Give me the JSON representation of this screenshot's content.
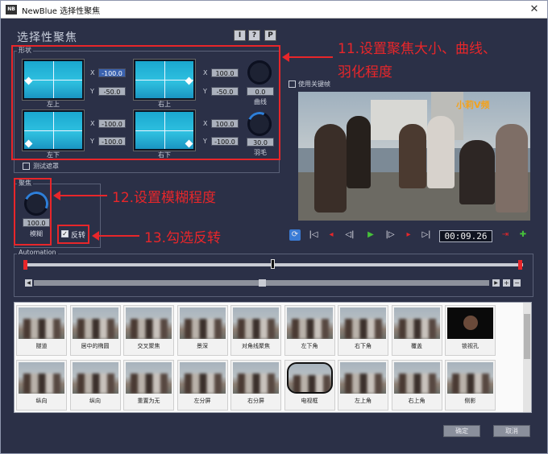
{
  "window": {
    "app_icon_text": "NB",
    "title": "NewBlue 选择性聚焦",
    "close_glyph": "✕"
  },
  "dialog": {
    "title": "选择性聚焦",
    "header_buttons": [
      "I",
      "?",
      "P"
    ]
  },
  "shape_group": {
    "label": "形状",
    "pads": [
      {
        "name": "top-left",
        "label": "左上",
        "x": "-100.0",
        "y": "-50.0"
      },
      {
        "name": "top-right",
        "label": "右上",
        "x": "100.0",
        "y": "-50.0"
      },
      {
        "name": "bottom-left",
        "label": "左下",
        "x": "-100.0",
        "y": "-100.0"
      },
      {
        "name": "bottom-right",
        "label": "右下",
        "x": "100.0",
        "y": "-100.0"
      }
    ],
    "curve_knob": {
      "value": "0.0",
      "label": "曲线"
    },
    "feather_knob": {
      "value": "30.0",
      "label": "羽毛"
    },
    "test_mask_label": "测试遮罩"
  },
  "focus_group": {
    "label": "聚焦",
    "blur_knob": {
      "value": "100.0",
      "label": "模糊"
    },
    "invert_label": "反转",
    "invert_checked": true
  },
  "keyframes": {
    "label": "使用关键帧"
  },
  "video": {
    "watermark": "小莉V频"
  },
  "transport": {
    "timecode": "00:09.26",
    "icons": [
      "loop-icon",
      "go-start-icon",
      "prev-keyframe-icon",
      "step-back-icon",
      "play-icon",
      "step-forward-icon",
      "next-keyframe-icon",
      "go-end-icon",
      "delete-keyframe-icon",
      "add-keyframe-icon"
    ]
  },
  "automation": {
    "label": "Automation"
  },
  "presets": [
    {
      "label": "隧道"
    },
    {
      "label": "居中的椭圆"
    },
    {
      "label": "交叉聚焦"
    },
    {
      "label": "景深"
    },
    {
      "label": "对角线聚焦"
    },
    {
      "label": "左下角"
    },
    {
      "label": "右下角"
    },
    {
      "label": "覆盖"
    },
    {
      "label": "锁视孔"
    },
    {
      "label": "纵向"
    },
    {
      "label": "纵向"
    },
    {
      "label": "重置为无"
    },
    {
      "label": "左分屏"
    },
    {
      "label": "右分屏"
    },
    {
      "label": "电视框"
    },
    {
      "label": "左上角"
    },
    {
      "label": "右上角"
    },
    {
      "label": "侧影"
    }
  ],
  "buttons": {
    "ok": "确定",
    "cancel": "取消"
  },
  "annotations": {
    "a11_line1": "11.设置聚焦大小、曲线、",
    "a11_line2": "羽化程度",
    "a12": "12.设置模糊程度",
    "a13": "13.勾选反转"
  },
  "colors": {
    "accent_red": "#e8262a",
    "panel_bg": "#2b3047",
    "pad_cyan": "#2fc1e0"
  }
}
